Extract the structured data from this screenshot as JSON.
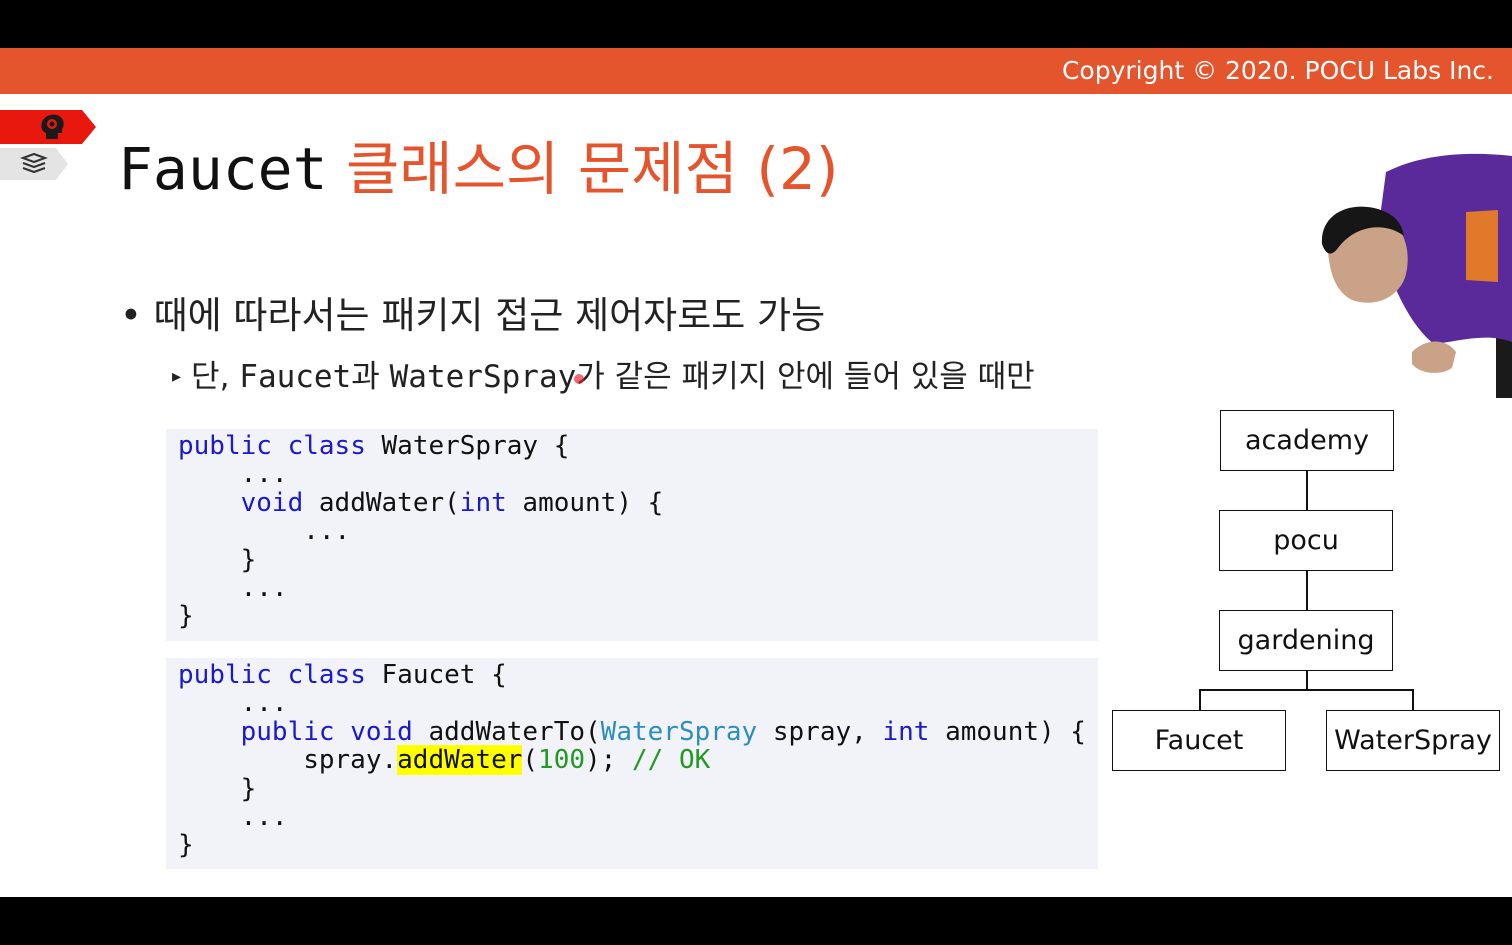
{
  "banner": {
    "copyright": "Copyright © 2020. POCU Labs Inc."
  },
  "side_tags": {
    "top_icon": "brain-head-icon",
    "bottom_icon": "books-icon"
  },
  "title": {
    "code_part": "Faucet",
    "rest": " 클래스의 문제점 (2)"
  },
  "bullets": [
    {
      "text": "• 때에 따라서는 패키지 접근 제어자로도 가능"
    },
    {
      "marker": "▸",
      "part1": "단, ",
      "code1": "Faucet",
      "part2": "과 ",
      "code2": "WaterSpray",
      "part3": "가 같은 패키지 안에 들어 있을 때만"
    }
  ],
  "code_block_1": {
    "l1_kw1": "public",
    "l1_kw2": "class",
    "l1_rest": "WaterSpray {",
    "l2": "    ...",
    "l3_kw": "void",
    "l3_a": "addWater(",
    "l3_kw2": "int",
    "l3_b": " amount) {",
    "l4": "        ...",
    "l5": "    }",
    "l6": "    ...",
    "l7": "}"
  },
  "code_block_2": {
    "l1_kw1": "public",
    "l1_kw2": "class",
    "l1_rest": "Faucet {",
    "l2": "    ...",
    "l3_kw1": "public",
    "l3_kw2": "void",
    "l3_a": "addWaterTo(",
    "l3_type": "WaterSpray",
    "l3_b": " spray, ",
    "l3_kw3": "int",
    "l3_c": " amount) {",
    "l4_a": "        spray.",
    "l4_hl": "addWater",
    "l4_b": "(",
    "l4_num": "100",
    "l4_c": "); ",
    "l4_comment": "// OK",
    "l5": "    }",
    "l6": "    ...",
    "l7": "}"
  },
  "package_tree": {
    "nodes": [
      "academy",
      "pocu",
      "gardening",
      "Faucet",
      "WaterSpray"
    ]
  },
  "colors": {
    "accent": "#e5552d",
    "keyword": "#1a1ac8",
    "type": "#2b8fbd",
    "comment": "#229922",
    "highlight": "#ffff00",
    "code_bg": "#f2f2f9"
  }
}
